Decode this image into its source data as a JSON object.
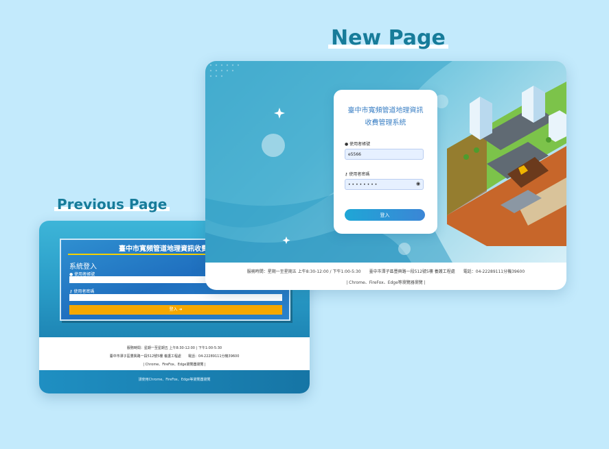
{
  "headings": {
    "new_page": "New Page",
    "previous_page": "Previous Page"
  },
  "previous": {
    "panel_title": "臺中市寬頻管道地理資訊收費",
    "login_title": "系統登入",
    "username_label": "使用者帳號",
    "password_label": "使用者密碼",
    "login_button": "登入 ➜",
    "footer_line1": "服務時間：星期一至星期五 上午8:30-12:00 | 下午1:00-5:30",
    "footer_line2": "臺中市潭子區豐興路一段512號5樓 養護工程處　　電話：04-22289111分機39600",
    "footer_line3": "| Chrome、FireFox、Edge瀏覽器瀏覽 |",
    "bottom_text": "請使用Chrome、FireFox、Edge等瀏覽器瀏覽"
  },
  "new": {
    "title_line1": "臺中市寬頻管道地理資訊",
    "title_line2": "收費管理系統",
    "username_label": "使用者帳號",
    "username_value": "e5566",
    "password_label": "使用者密碼",
    "password_value": "••••••••",
    "login_button": "登入",
    "footer_line1": "服務時間：星期一至星期五 上午8:30-12:00 / 下午1:00-5:30　　臺中市潭子區豐興路一段512號5樓 養護工程處　　電話：04-22289111分機39600",
    "footer_line2": "| Chrome、FireFox、Edge等瀏覽器瀏覽 |"
  },
  "colors": {
    "page_bg": "#c3eafc",
    "heading": "#177c9a",
    "accent_blue": "#3a7fc4",
    "prev_button": "#f6a800"
  }
}
